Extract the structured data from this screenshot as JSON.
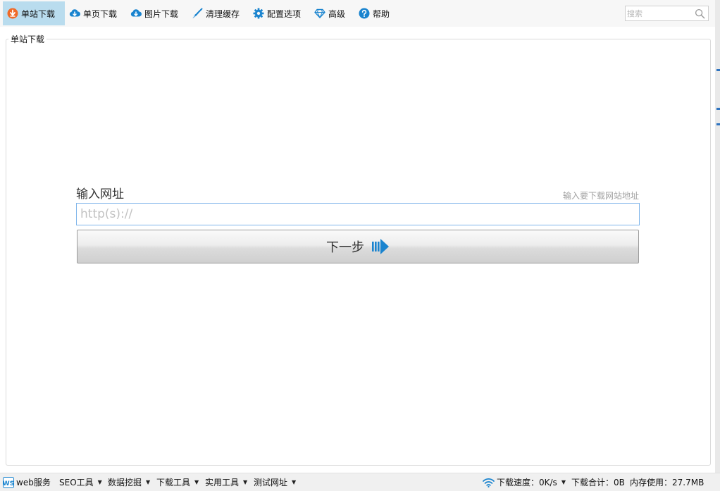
{
  "toolbar": {
    "items": [
      {
        "label": "单站下载",
        "icon": "download-orange-icon"
      },
      {
        "label": "单页下载",
        "icon": "cloud-download-icon"
      },
      {
        "label": "图片下载",
        "icon": "cloud-download-icon"
      },
      {
        "label": "清理缓存",
        "icon": "broom-icon"
      },
      {
        "label": "配置选项",
        "icon": "gear-icon"
      },
      {
        "label": "高级",
        "icon": "diamond-icon"
      },
      {
        "label": "帮助",
        "icon": "help-icon"
      }
    ],
    "active_index": 0,
    "search_placeholder": "搜索"
  },
  "group": {
    "title": "单站下载"
  },
  "form": {
    "label": "输入网址",
    "hint": "输入要下载网站地址",
    "placeholder": "http(s)://",
    "value": "",
    "next_button": "下一步"
  },
  "statusbar": {
    "left": [
      {
        "label": "web服务",
        "icon": "web-service-icon",
        "dropdown": false
      },
      {
        "label": "SEO工具",
        "dropdown": true
      },
      {
        "label": "数据挖掘",
        "dropdown": true
      },
      {
        "label": "下载工具",
        "dropdown": true
      },
      {
        "label": "实用工具",
        "dropdown": true
      },
      {
        "label": "测试网址",
        "dropdown": true
      }
    ],
    "speed": "下载速度：0K/s",
    "total": "下载合计：0B",
    "memory": "内存使用：27.7MB"
  },
  "colors": {
    "accent_blue": "#1a84cf",
    "active_tab": "#b9dcee",
    "orange": "#f06a28"
  }
}
